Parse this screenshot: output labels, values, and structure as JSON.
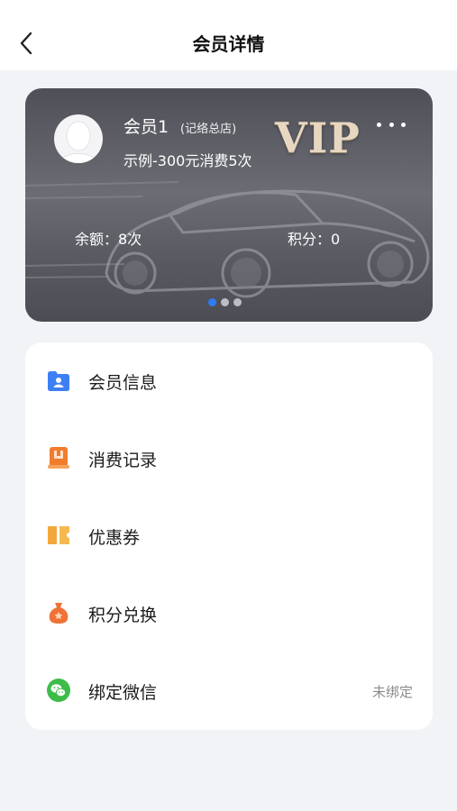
{
  "header": {
    "title": "会员详情",
    "back_icon": "chevron-left-icon"
  },
  "card": {
    "member_name": "会员1",
    "store": "(记络总店)",
    "plan": "示例-300元消费5次",
    "badge": "VIP",
    "balance": "余额：8次",
    "points": "积分：0",
    "pager": {
      "count": 3,
      "active_index": 0
    },
    "colors": {
      "card_bg": "#55565d",
      "badge_gold": "#e8d7c0",
      "active_dot": "#2d7cf6"
    }
  },
  "menu": {
    "items": [
      {
        "label": "会员信息",
        "icon": "member-folder-icon",
        "icon_color": "#3d7ff5"
      },
      {
        "label": "消费记录",
        "icon": "record-book-icon",
        "icon_color": "#f07c2c"
      },
      {
        "label": "优惠券",
        "icon": "coupon-icon",
        "icon_color": "#f4a83a"
      },
      {
        "label": "积分兑换",
        "icon": "money-bag-icon",
        "icon_color": "#f07236"
      },
      {
        "label": "绑定微信",
        "icon": "wechat-icon",
        "icon_color": "#3ebc4a",
        "status": "未绑定"
      }
    ]
  }
}
